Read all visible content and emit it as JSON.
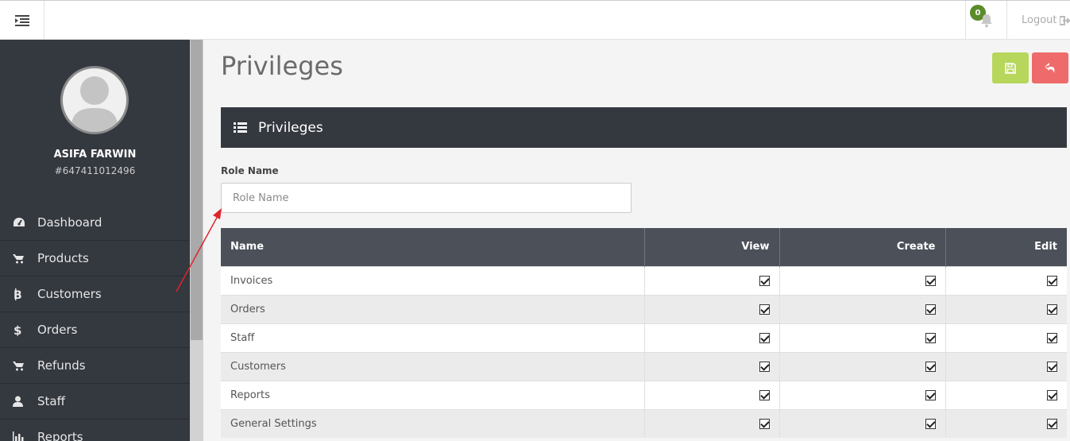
{
  "topbar": {
    "notification_count": "0",
    "logout_label": "Logout"
  },
  "user": {
    "name": "ASIFA FARWIN",
    "id": "#647411012496"
  },
  "sidebar": {
    "items": [
      {
        "label": "Dashboard",
        "icon": "dashboard-icon"
      },
      {
        "label": "Products",
        "icon": "cart-icon"
      },
      {
        "label": "Customers",
        "icon": "bitcoin-icon"
      },
      {
        "label": "Orders",
        "icon": "dollar-icon"
      },
      {
        "label": "Refunds",
        "icon": "cart-icon"
      },
      {
        "label": "Staff",
        "icon": "user-icon"
      },
      {
        "label": "Reports",
        "icon": "bar-chart-icon"
      }
    ]
  },
  "page": {
    "title": "Privileges",
    "panel_title": "Privileges"
  },
  "form": {
    "role_label": "Role Name",
    "role_placeholder": "Role Name",
    "role_value": ""
  },
  "table": {
    "columns": [
      "Name",
      "View",
      "Create",
      "Edit"
    ],
    "rows": [
      {
        "name": "Invoices",
        "view": true,
        "create": true,
        "edit": true
      },
      {
        "name": "Orders",
        "view": true,
        "create": true,
        "edit": true
      },
      {
        "name": "Staff",
        "view": true,
        "create": true,
        "edit": true
      },
      {
        "name": "Customers",
        "view": true,
        "create": true,
        "edit": true
      },
      {
        "name": "Reports",
        "view": true,
        "create": true,
        "edit": true
      },
      {
        "name": "General Settings",
        "view": true,
        "create": true,
        "edit": true
      }
    ]
  },
  "colors": {
    "sidebar_bg": "#34383f",
    "table_header_bg": "#4b5059",
    "save_button": "#b7d65c",
    "back_button": "#ef6a6a",
    "badge": "#5b8c2b",
    "annotation_arrow": "#e0242c"
  }
}
